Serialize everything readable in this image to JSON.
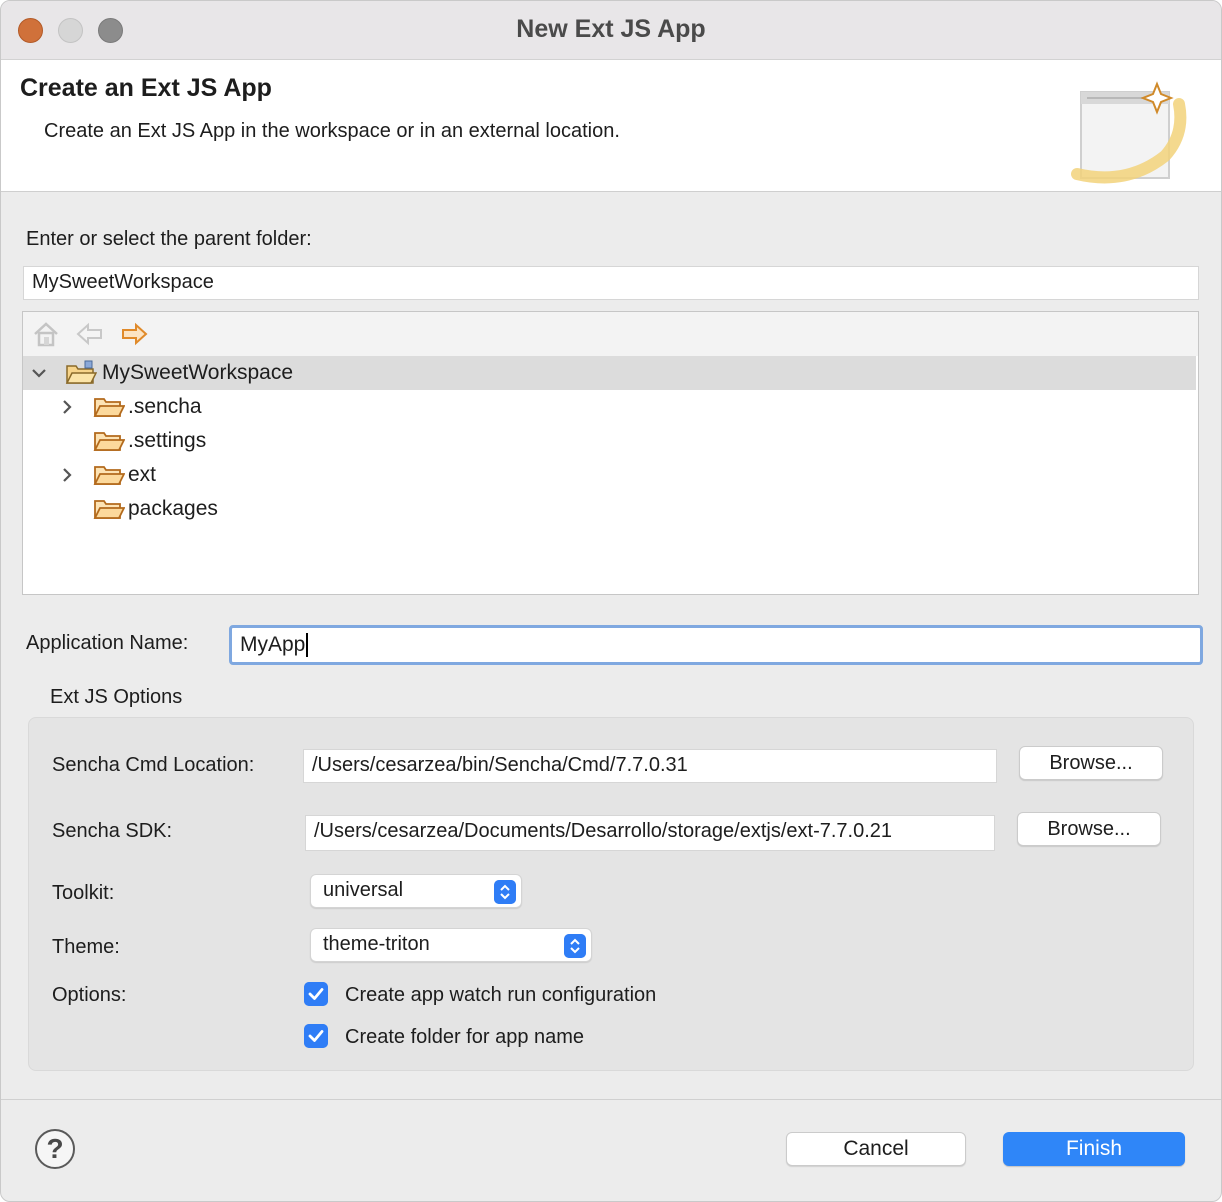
{
  "window": {
    "title": "New Ext JS App"
  },
  "banner": {
    "title": "Create an Ext JS App",
    "description": "Create an Ext JS App in the workspace or in an external location."
  },
  "parent_folder": {
    "label": "Enter or select the parent folder:",
    "value": "MySweetWorkspace"
  },
  "tree": {
    "toolbar": {
      "home_icon": "home-icon",
      "back_icon": "arrow-left-icon",
      "forward_icon": "arrow-right-icon"
    },
    "root": {
      "label": "MySweetWorkspace",
      "expanded": true
    },
    "children": [
      {
        "label": ".sencha",
        "expandable": true
      },
      {
        "label": ".settings",
        "expandable": false
      },
      {
        "label": "ext",
        "expandable": true
      },
      {
        "label": "packages",
        "expandable": false
      }
    ]
  },
  "app_name": {
    "label": "Application Name:",
    "value": "MyApp"
  },
  "ext_options": {
    "group_label": "Ext JS Options",
    "cmd_location": {
      "label": "Sencha Cmd Location:",
      "value": "/Users/cesarzea/bin/Sencha/Cmd/7.7.0.31",
      "browse_label": "Browse..."
    },
    "sdk": {
      "label": "Sencha SDK:",
      "value": "/Users/cesarzea/Documents/Desarrollo/storage/extjs/ext-7.7.0.21",
      "browse_label": "Browse..."
    },
    "toolkit": {
      "label": "Toolkit:",
      "value": "universal"
    },
    "theme": {
      "label": "Theme:",
      "value": "theme-triton"
    },
    "options": {
      "label": "Options:",
      "items": [
        {
          "label": "Create app watch run configuration",
          "checked": true
        },
        {
          "label": "Create folder for app name",
          "checked": true
        }
      ]
    }
  },
  "footer": {
    "help_label": "?",
    "cancel_label": "Cancel",
    "finish_label": "Finish"
  },
  "colors": {
    "accent": "#2f86f8",
    "close_button": "#d0713a",
    "folder": "#e8a94e"
  }
}
